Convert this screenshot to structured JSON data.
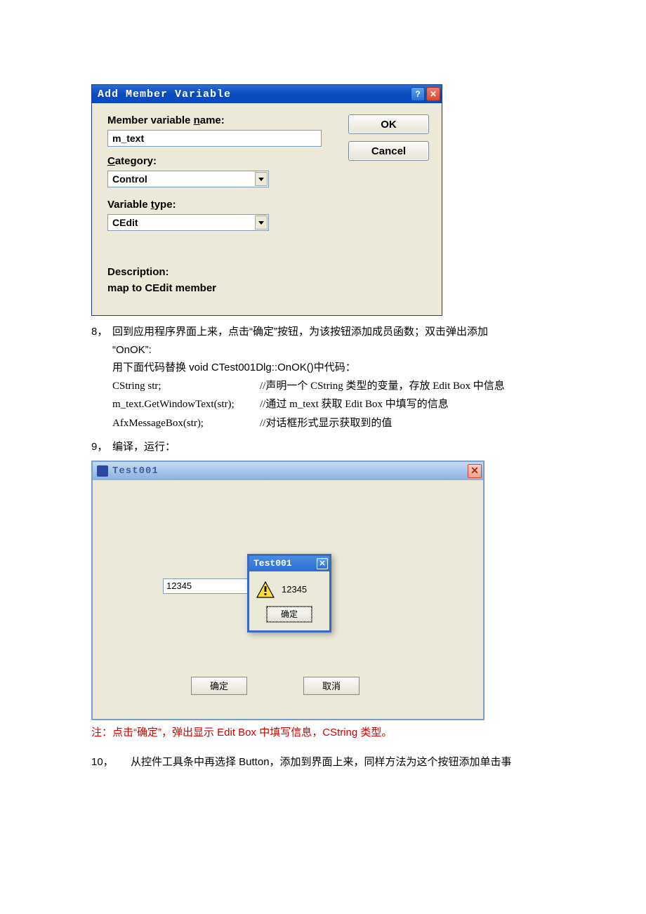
{
  "dlg1": {
    "title": "Add Member Variable",
    "label_name_prefix": "Member variable ",
    "label_name_u": "n",
    "label_name_suffix": "ame:",
    "input_name": "m_text",
    "label_category_u": "C",
    "label_category_suffix": "ategory:",
    "combo_category": "Control",
    "label_type_prefix": "Variable ",
    "label_type_u": "t",
    "label_type_suffix": "ype:",
    "combo_type": "CEdit",
    "desc_label": "Description:",
    "desc_text": "map to CEdit member",
    "btn_ok": "OK",
    "btn_cancel": "Cancel"
  },
  "para": {
    "p8_num": "8，",
    "p8_line1": "回到应用程序界面上来，点击“确定”按钮，为该按钮添加成员函数；双击弹出添加",
    "p8_line2": "“OnOK”:",
    "p8_line3": "用下面代码替换 void CTest001Dlg::OnOK()中代码：",
    "code1_a": "CString str;",
    "code1_b": "//声明一个 CString 类型的变量，存放 Edit Box 中信息",
    "code2_a": " m_text.GetWindowText(str);",
    "code2_b": "//通过 m_text 获取 Edit Box 中填写的信息",
    "code3_a": " AfxMessageBox(str);",
    "code3_b": "//对话框形式显示获取到的值",
    "p9_num": "9，",
    "p9_text": "编译，运行：",
    "note": "注：点击“确定”，弹出显示 Edit Box 中填写信息，CString 类型。",
    "p10_num": "10，",
    "p10_text": "从控件工具条中再选择 Button，添加到界面上来，同样方法为这个按钮添加单击事"
  },
  "dlg2": {
    "title": "Test001",
    "edit_value": "12345",
    "btn_ok": "确定",
    "btn_cancel": "取消"
  },
  "msg": {
    "title": "Test001",
    "text": "12345",
    "btn": "确定"
  }
}
